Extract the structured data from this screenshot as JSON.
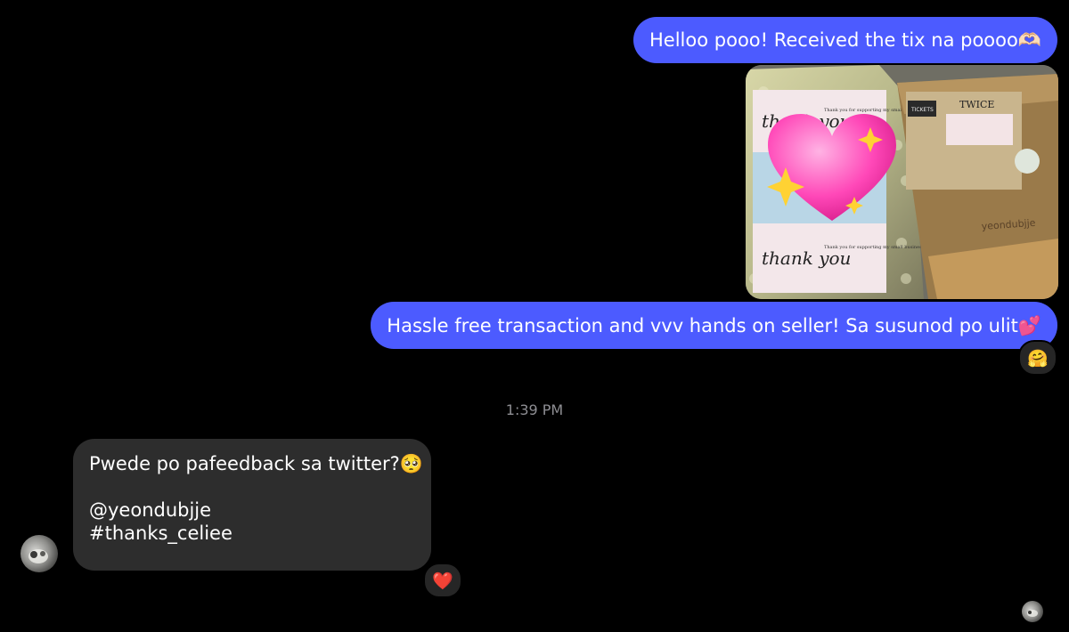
{
  "messages": [
    {
      "id": "msg1",
      "direction": "outgoing",
      "type": "text",
      "text": "Helloo pooo! Received the tix na poooo🫶🏻"
    },
    {
      "id": "msg2",
      "direction": "outgoing",
      "type": "image",
      "image_text": {
        "sticker_top": "thank you",
        "sticker_top_small": "Thank you for supporting my small business!",
        "sticker_bottom": "thank you",
        "sticker_bottom_small": "Thank you for supporting my small business!",
        "box_label": "TWICE",
        "box_handle": "yeondubjje",
        "tickets_label": "TICKETS",
        "emoji": "💖"
      }
    },
    {
      "id": "msg3",
      "direction": "outgoing",
      "type": "text",
      "text": "Hassle free transaction and vvv hands on seller! Sa susunod po ulit💕",
      "reaction": "🤗"
    },
    {
      "id": "msg4",
      "direction": "incoming",
      "type": "text",
      "lines": [
        "Pwede po pafeedback sa twitter?🥺",
        "",
        "@yeondubjje",
        "#thanks_celiee"
      ],
      "reaction": "❤️"
    }
  ],
  "timestamp": "1:39 PM",
  "colors": {
    "background": "#000000",
    "outgoing_bubble": "#4c5bff",
    "incoming_bubble": "#2d2d2d",
    "timestamp": "#8e8e93",
    "reaction_bg": "#262626"
  },
  "icons": {
    "contact_avatar": "avatar-photo",
    "read_receipt": "read-receipt-avatar"
  }
}
